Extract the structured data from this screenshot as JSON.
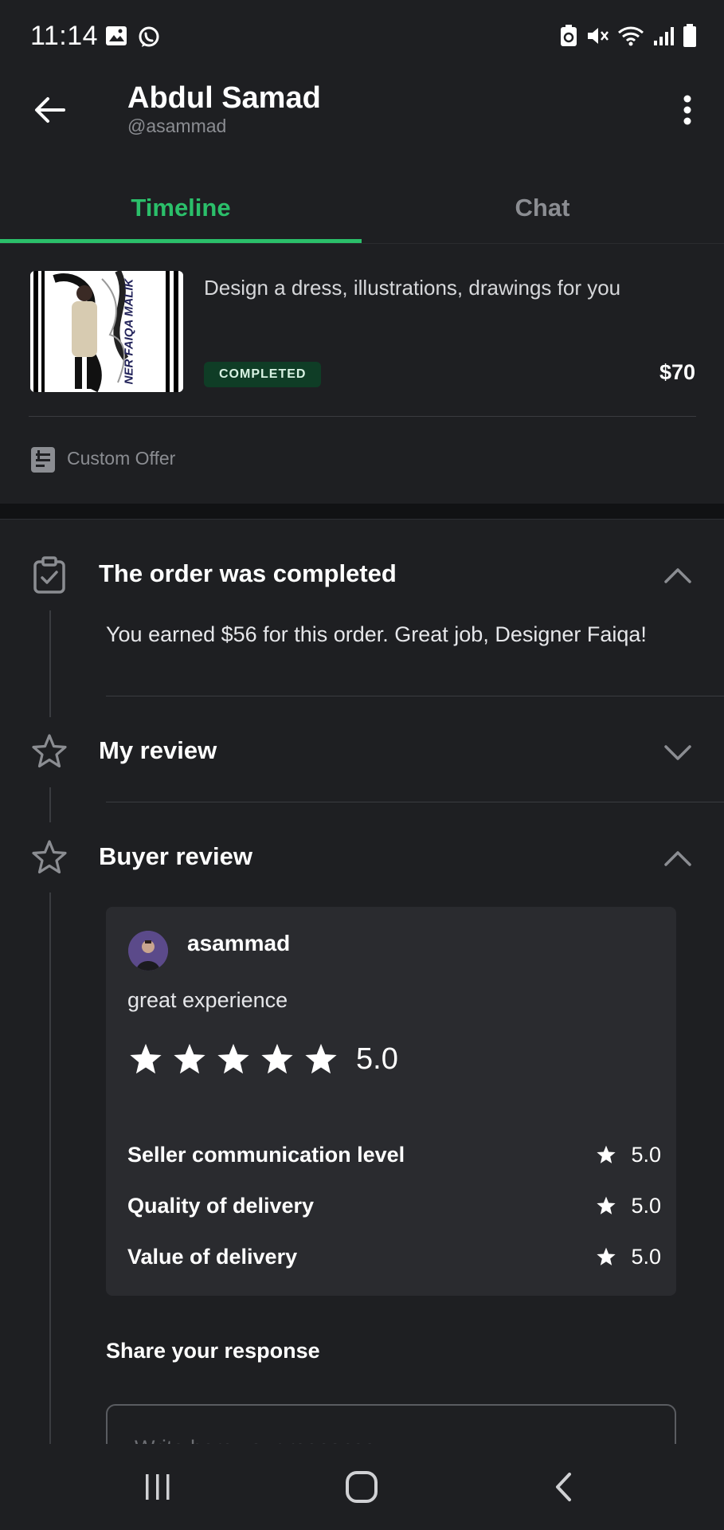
{
  "status_bar": {
    "time": "11:14",
    "left_icons": [
      "image-icon",
      "whatsapp-icon"
    ],
    "right_icons": [
      "recycle-icon",
      "mute-icon",
      "wifi-icon",
      "signal-icon",
      "battery-icon"
    ]
  },
  "header": {
    "name": "Abdul Samad",
    "handle": "@asammad"
  },
  "tabs": [
    {
      "label": "Timeline",
      "active": true
    },
    {
      "label": "Chat",
      "active": false
    }
  ],
  "order": {
    "title": "Design a dress, illustrations, drawings for you",
    "status": "COMPLETED",
    "price": "$70",
    "offer_type": "Custom Offer",
    "thumbnail_text": "NER FAIQA MALIK"
  },
  "timeline": {
    "completed": {
      "title": "The order was completed",
      "message": "You earned $56 for this order. Great job, Designer Faiqa!"
    },
    "my_review": {
      "title": "My review"
    },
    "buyer_review": {
      "title": "Buyer review",
      "reviewer": "asammad",
      "comment": "great experience",
      "overall_rating": "5.0",
      "stars": 5,
      "metrics": [
        {
          "label": "Seller communication level",
          "value": "5.0"
        },
        {
          "label": "Quality of delivery",
          "value": "5.0"
        },
        {
          "label": "Value of delivery",
          "value": "5.0"
        }
      ]
    }
  },
  "response": {
    "label": "Share your response",
    "placeholder": "Write here your response"
  },
  "colors": {
    "accent": "#2bbf6a",
    "background": "#1e1f22",
    "card": "#2a2b2f",
    "badge_bg": "#0f3d26"
  }
}
